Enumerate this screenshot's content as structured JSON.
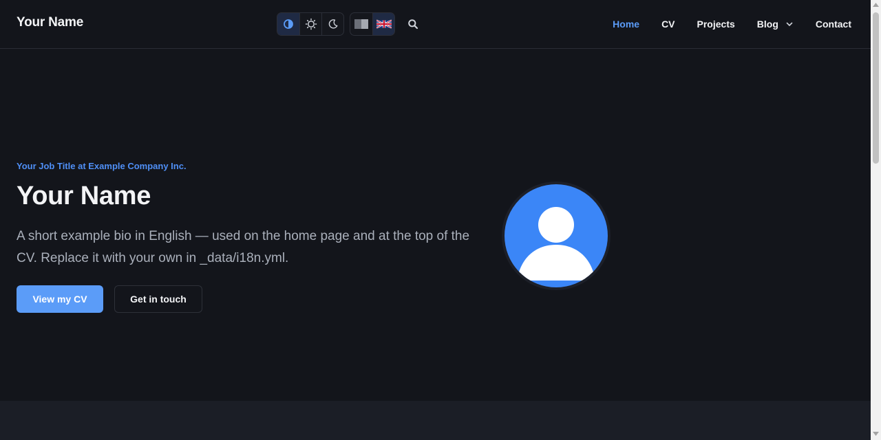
{
  "header": {
    "brand": "Your Name",
    "theme_buttons": [
      {
        "icon": "contrast-icon",
        "label": "Auto",
        "active": true
      },
      {
        "icon": "sun-icon",
        "label": "Light",
        "active": false
      },
      {
        "icon": "moon-icon",
        "label": "Dark",
        "active": false
      }
    ],
    "lang_buttons": [
      {
        "icon": "language-neutral-icon",
        "active": false
      },
      {
        "icon": "uk-flag-icon",
        "active": true
      }
    ],
    "search_icon": "search-icon",
    "nav": [
      {
        "label": "Home",
        "active": true
      },
      {
        "label": "CV",
        "active": false
      },
      {
        "label": "Projects",
        "active": false
      },
      {
        "label": "Blog",
        "active": false,
        "dropdown": true
      },
      {
        "label": "Contact",
        "active": false
      }
    ]
  },
  "hero": {
    "eyebrow": "Your Job Title at Example Company Inc.",
    "title": "Your Name",
    "bio": "A short example bio in English — used on the home page and at the top of the CV. Replace it with your own in _data/i18n.yml.",
    "primary_button": "View my CV",
    "secondary_button": "Get in touch",
    "avatar_icon": "user-avatar-icon"
  },
  "colors": {
    "background": "#13151b",
    "accent": "#5b9cf8",
    "avatar": "#3b86f7",
    "band": "#1b1e26"
  }
}
